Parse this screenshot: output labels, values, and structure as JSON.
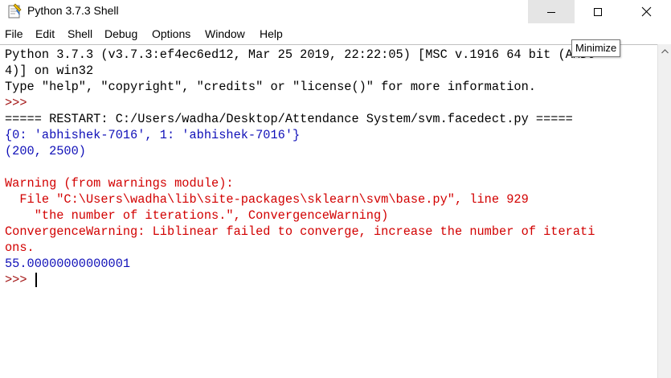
{
  "window": {
    "title": "Python 3.7.3 Shell",
    "app_icon": "python-idle-icon",
    "controls": {
      "minimize_icon": "minimize-icon",
      "maximize_icon": "maximize-icon",
      "close_icon": "close-icon"
    }
  },
  "menu": [
    "File",
    "Edit",
    "Shell",
    "Debug",
    "Options",
    "Window",
    "Help"
  ],
  "tooltip": "Minimize",
  "shell": {
    "lines": [
      {
        "text": "Python 3.7.3 (v3.7.3:ef4ec6ed12, Mar 25 2019, 22:22:05) [MSC v.1916 64 bit (AMD6",
        "kind": "out"
      },
      {
        "text": "4)] on win32",
        "kind": "out"
      },
      {
        "text": "Type \"help\", \"copyright\", \"credits\" or \"license()\" for more information.",
        "kind": "out"
      },
      {
        "text": ">>> ",
        "kind": "prompt"
      },
      {
        "text": "===== RESTART: C:/Users/wadha/Desktop/Attendance System/svm.facedect.py =====",
        "kind": "out"
      },
      {
        "text": "{0: 'abhishek-7016', 1: 'abhishek-7016'}",
        "kind": "blue"
      },
      {
        "text": "(200, 2500)",
        "kind": "blue"
      },
      {
        "text": "",
        "kind": "out"
      },
      {
        "text": "Warning (from warnings module):",
        "kind": "err"
      },
      {
        "text": "  File \"C:\\Users\\wadha\\lib\\site-packages\\sklearn\\svm\\base.py\", line 929",
        "kind": "err"
      },
      {
        "text": "    \"the number of iterations.\", ConvergenceWarning)",
        "kind": "err"
      },
      {
        "text": "ConvergenceWarning: Liblinear failed to converge, increase the number of iterati",
        "kind": "err"
      },
      {
        "text": "ons.",
        "kind": "err"
      },
      {
        "text": "55.00000000000001",
        "kind": "blue"
      },
      {
        "text": ">>> ",
        "kind": "prompt"
      }
    ]
  },
  "scrollbar": {
    "up_arrow_icon": "scroll-up-arrow-icon"
  },
  "colors": {
    "output": "#000000",
    "prompt": "#a31515",
    "stdout_blue": "#1010b8",
    "stderr_red": "#d20000",
    "minimize_hover": "#e5e5e5"
  }
}
